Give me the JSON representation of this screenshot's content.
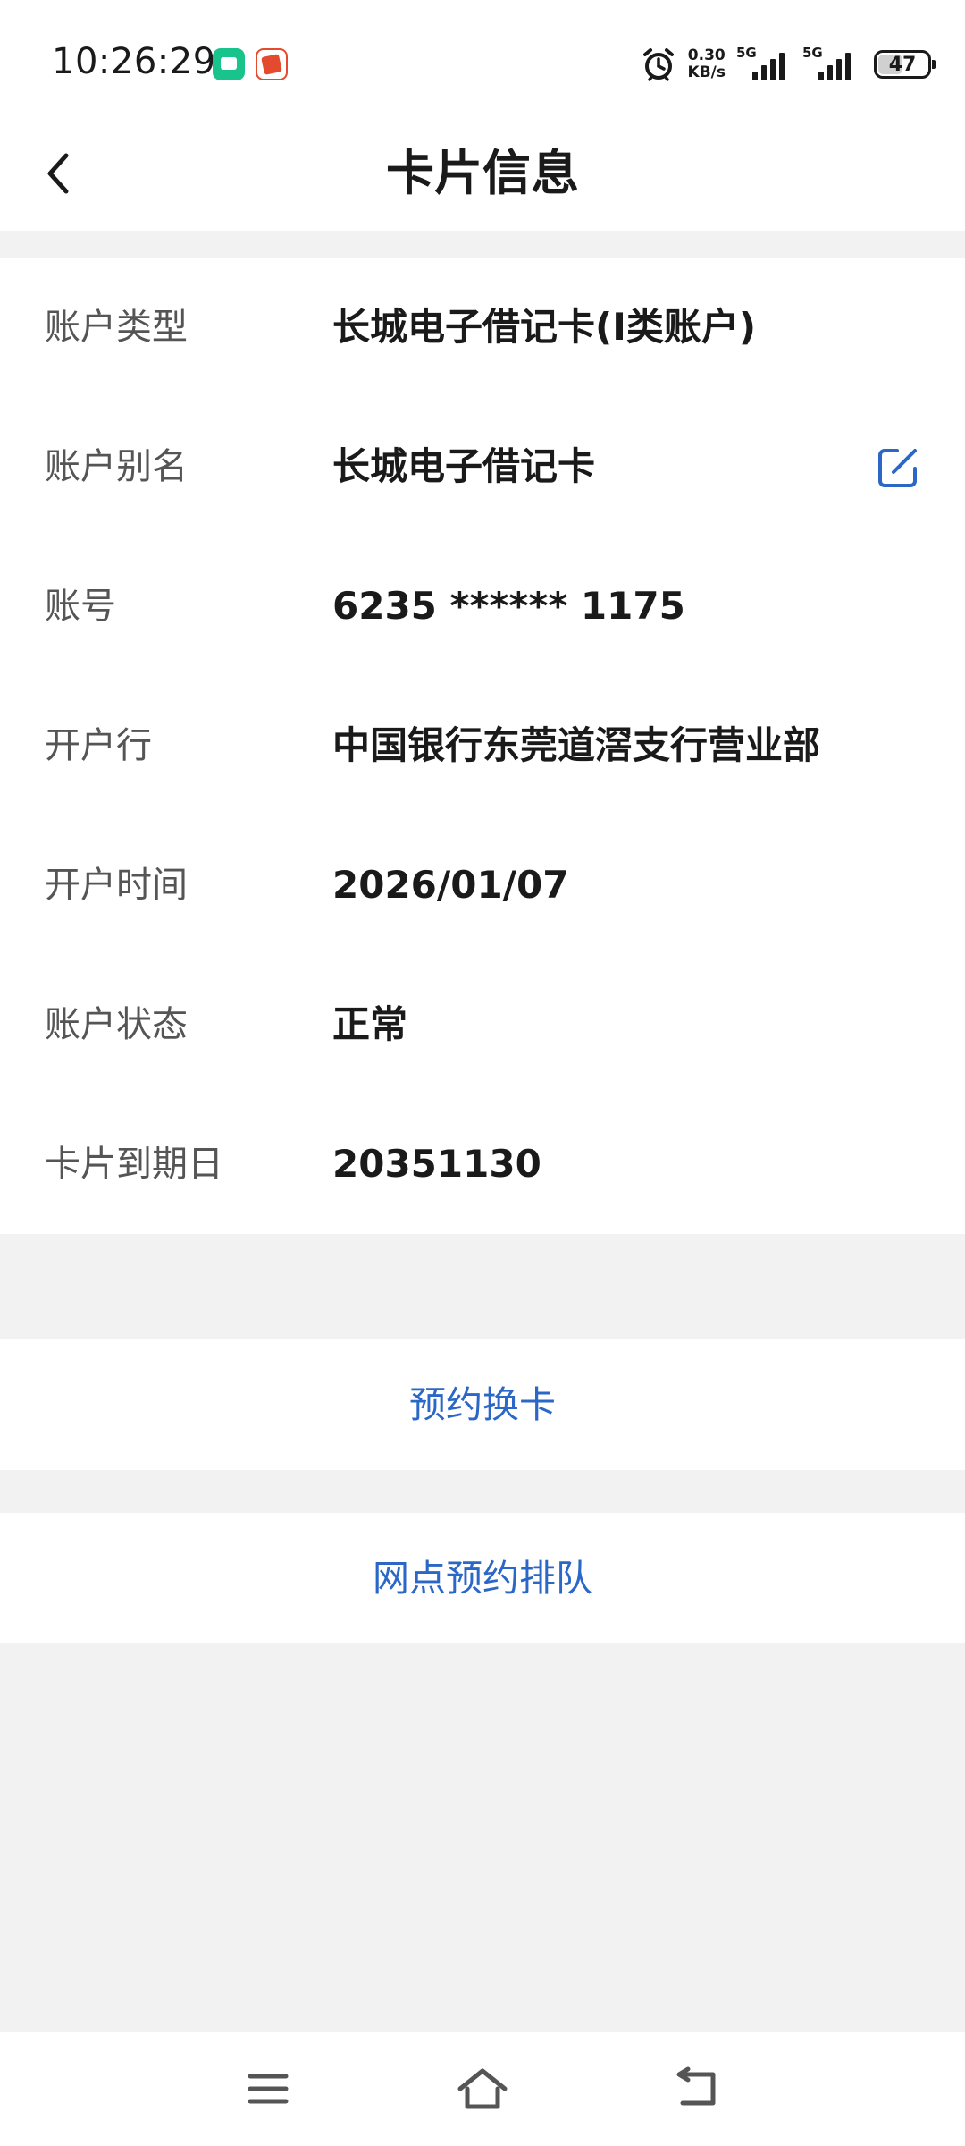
{
  "status_bar": {
    "time": "10:26:29",
    "net_speed_value": "0.30",
    "net_speed_unit": "KB/s",
    "network_1": "5G",
    "network_2": "5G",
    "battery": "47",
    "icons": [
      "chat-app-icon",
      "news-app-icon",
      "alarm-icon",
      "signal-icon",
      "battery-icon"
    ]
  },
  "header": {
    "title": "卡片信息",
    "back_icon": "chevron-left-icon"
  },
  "info": {
    "rows": [
      {
        "label": "账户类型",
        "value": "长城电子借记卡(I类账户)"
      },
      {
        "label": "账户别名",
        "value": "长城电子借记卡"
      },
      {
        "label": "账号",
        "value": "6235 ****** 1175"
      },
      {
        "label": "开户行",
        "value": "中国银行东莞道滘支行营业部"
      },
      {
        "label": "开户时间",
        "value": "2026/01/07"
      },
      {
        "label": "账户状态",
        "value": "正常"
      },
      {
        "label": "卡片到期日",
        "value": "20351130"
      }
    ],
    "edit_icon": "edit-icon"
  },
  "actions": {
    "reserve_card_label": "预约换卡",
    "reserve_queue_label": "网点预约排队"
  },
  "nav_bar": {
    "icons": [
      "menu-icon",
      "home-icon",
      "back-icon"
    ]
  },
  "colors": {
    "accent": "#2b67c6",
    "background": "#f2f2f2",
    "card": "#ffffff",
    "label": "#555555",
    "value": "#1a1a1a"
  }
}
